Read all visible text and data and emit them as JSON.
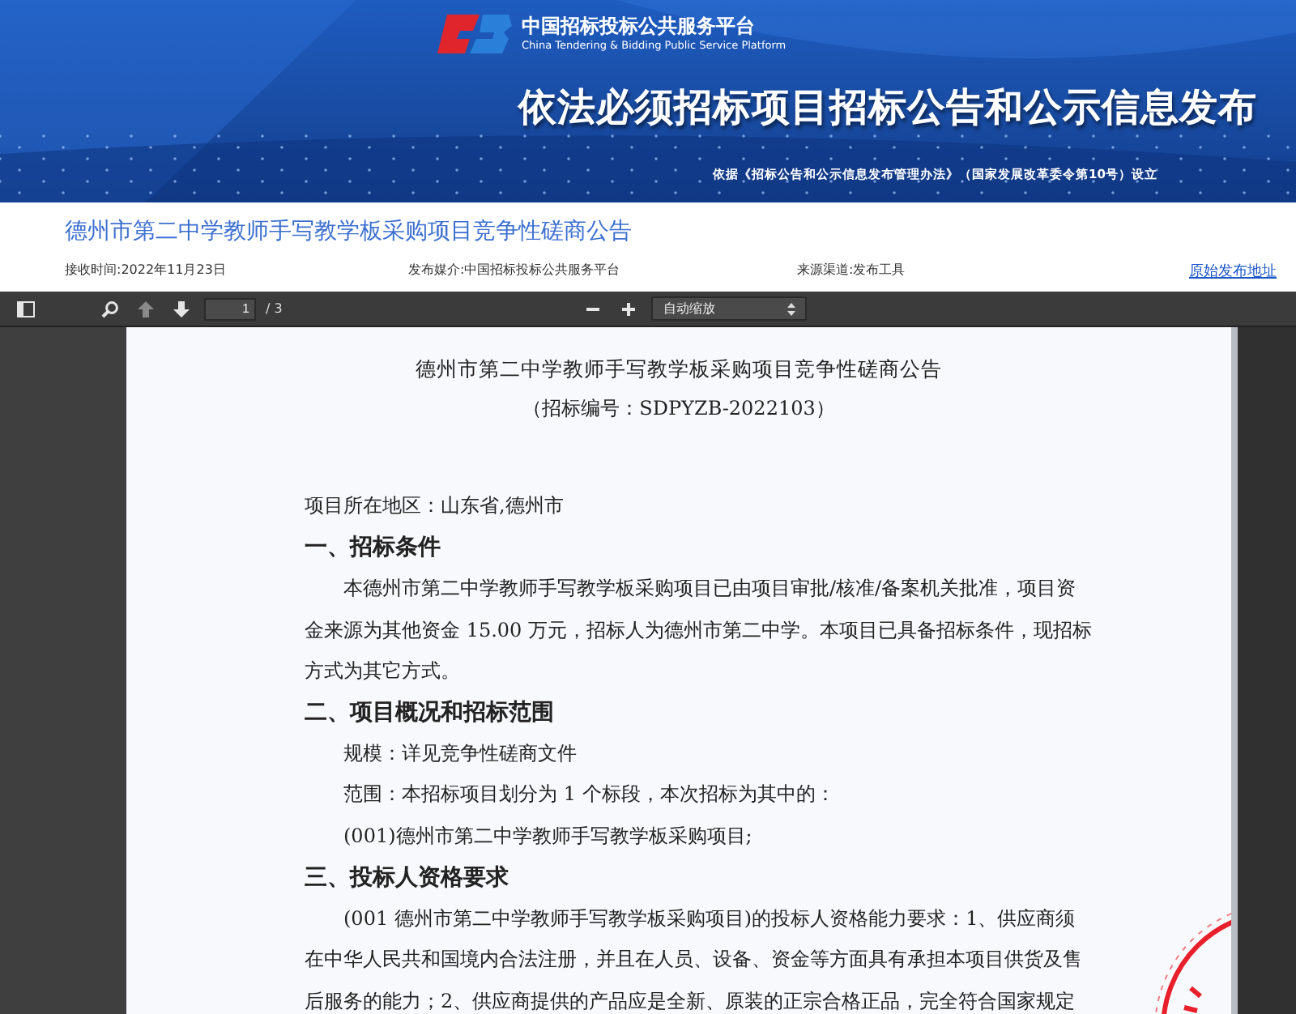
{
  "banner": {
    "platform_name": "中国招标投标公共服务平台",
    "platform_name_en": "China Tendering & Bidding Public Service Platform",
    "headline": "依法必须招标项目招标公告和公示信息发布",
    "basis": "依据《招标公告和公示信息发布管理办法》（国家发展改革委令第10号）设立"
  },
  "article": {
    "title": "德州市第二中学教师手写教学板采购项目竞争性磋商公告",
    "meta": [
      {
        "kind": "text",
        "text": "接收时间:2022年11月23日"
      },
      {
        "kind": "text",
        "text": "发布媒介:中国招标投标公共服务平台"
      },
      {
        "kind": "text",
        "text": "来源渠道:发布工具"
      },
      {
        "kind": "link",
        "text": "原始发布地址"
      }
    ]
  },
  "viewer_toolbar": {
    "page_number": "1",
    "page_total": "/ 3",
    "zoom": "自动缩放",
    "previous_disabled": true
  },
  "document": {
    "title": "德州市第二中学教师手写教学板采购项目竞争性磋商公告",
    "subtitle": "（招标编号：SDPYZB-2022103）",
    "blocks": [
      {
        "kind": "plain",
        "lines": [
          "项目所在地区：山东省,德州市"
        ]
      },
      {
        "kind": "heading",
        "lines": [
          "一、招标条件"
        ]
      },
      {
        "kind": "paragraph",
        "lines": [
          "本德州市第二中学教师手写教学板采购项目已由项目审批/核准/备案机关批准，项目资",
          "金来源为其他资金 15.00 万元，招标人为德州市第二中学。本项目已具备招标条件，现招标",
          "方式为其它方式。"
        ]
      },
      {
        "kind": "heading",
        "lines": [
          "二、项目概况和招标范围"
        ]
      },
      {
        "kind": "indented",
        "lines": [
          "规模：详见竞争性磋商文件"
        ]
      },
      {
        "kind": "indented",
        "lines": [
          "范围：本招标项目划分为 1 个标段，本次招标为其中的："
        ]
      },
      {
        "kind": "indented",
        "lines": [
          "(001)德州市第二中学教师手写教学板采购项目;"
        ]
      },
      {
        "kind": "heading",
        "lines": [
          "三、投标人资格要求"
        ]
      },
      {
        "kind": "paragraph",
        "lines": [
          "(001 德州市第二中学教师手写教学板采购项目)的投标人资格能力要求：1、供应商须",
          "在中华人民共和国境内合法注册，并且在人员、设备、资金等方面具有承担本项目供货及售",
          "后服务的能力；2、供应商提供的产品应是全新、原装的正宗合格正品，完全符合国家规定"
        ]
      }
    ]
  }
}
